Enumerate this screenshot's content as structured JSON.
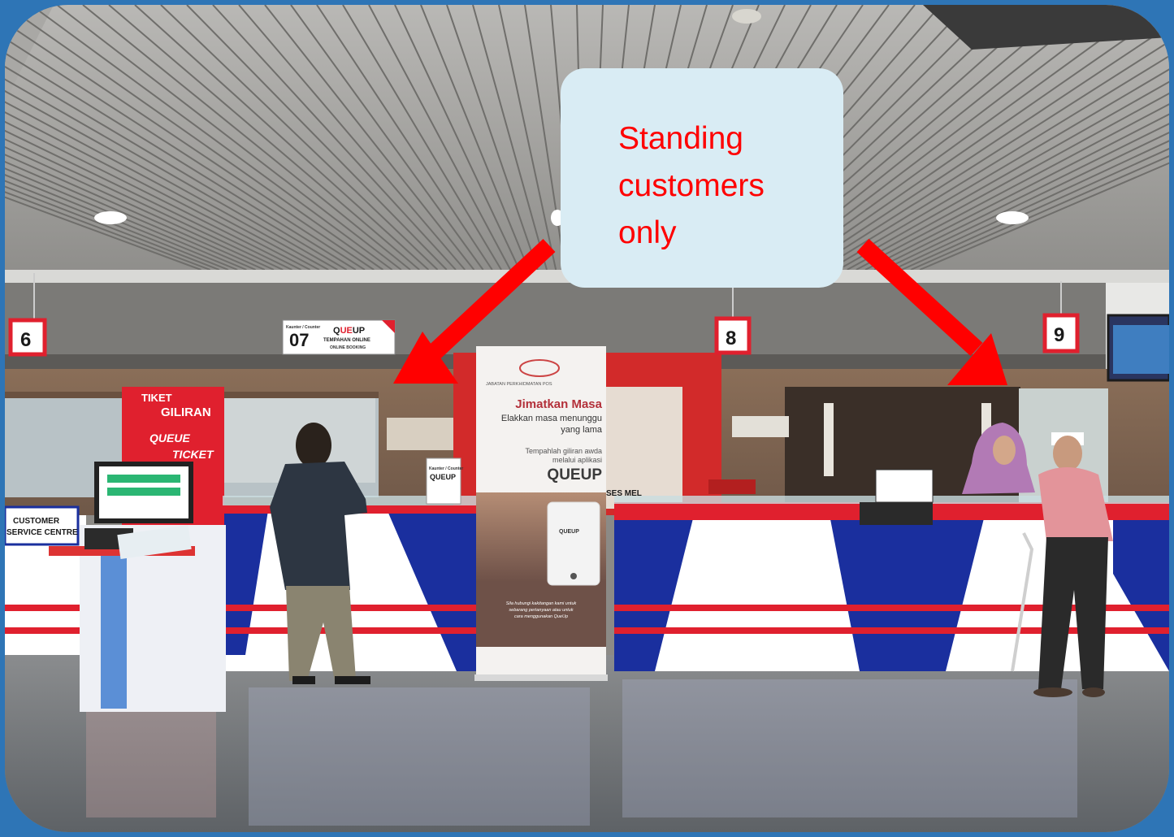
{
  "callout": {
    "text": "Standing\ncustomers\nonly",
    "text_color": "#ff0000",
    "bg_color": "#d9ecf4"
  },
  "colors": {
    "frame": "#2e75b6",
    "arrow": "#ff0000",
    "counter_blue": "#1a2f9e",
    "counter_red": "#e0202e"
  },
  "signs": {
    "counter_6": "6",
    "counter_7": "07",
    "counter_7_label": "Kaunter / Counter",
    "counter_7_brand_q": "Q",
    "counter_7_brand_ue": "UE",
    "counter_7_brand_up": "UP",
    "counter_7_line1": "TEMPAHAN ONLINE",
    "counter_7_line2": "ONLINE BOOKING",
    "counter_8": "8",
    "counter_9": "9",
    "ticket_line1": "TIKET",
    "ticket_line2": "GILIRAN",
    "ticket_line3": "QUEUE",
    "ticket_line4": "TICKET",
    "customer_service_1": "CUSTOMER",
    "customer_service_2": "SERVICE CENTRE"
  },
  "banner": {
    "org": "JABATAN PERKHIDMATAN POS",
    "headline": "Jimatkan Masa",
    "sub1": "Elakkan masa menunggu",
    "sub2": "yang lama",
    "cta1": "Tempahlah giliran awda",
    "cta2": "melalui aplikasi",
    "app_name": "QUEUP",
    "phone_label": "QUEUP",
    "contact1": "Sila hubungi kakitangan kami untuk",
    "contact2": "sebarang pertanyaan atau untuk",
    "contact3": "cara menggunakan QueUp"
  },
  "counter_card": {
    "label": "Kaunter / Counter",
    "brand": "QUEUP"
  },
  "wall_sign": "SES MEL"
}
